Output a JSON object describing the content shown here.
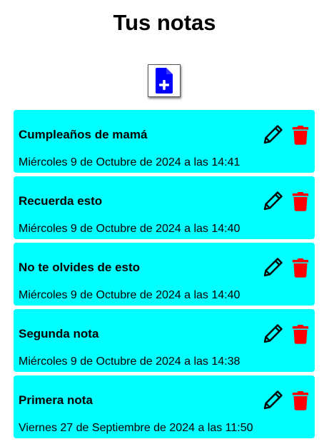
{
  "header": {
    "title": "Tus notas"
  },
  "toolbar": {
    "add_icon": "file-plus-icon",
    "add_icon_color": "#0000ff"
  },
  "colors": {
    "note_background": "#00ffff",
    "delete_icon": "#ff0000",
    "edit_icon": "#000000"
  },
  "notes": [
    {
      "title": "Cumpleaños de mamá",
      "date": "Miércoles 9 de Octubre de 2024 a las 14:41"
    },
    {
      "title": "Recuerda esto",
      "date": "Miércoles 9 de Octubre de 2024 a las 14:40"
    },
    {
      "title": "No te olvides de esto",
      "date": "Miércoles 9 de Octubre de 2024 a las 14:40"
    },
    {
      "title": "Segunda nota",
      "date": "Miércoles 9 de Octubre de 2024 a las 14:38"
    },
    {
      "title": "Primera nota",
      "date": "Viernes 27 de Septiembre de 2024 a las 11:50"
    }
  ],
  "icons": {
    "edit": "pencil-icon",
    "delete": "trash-icon"
  }
}
